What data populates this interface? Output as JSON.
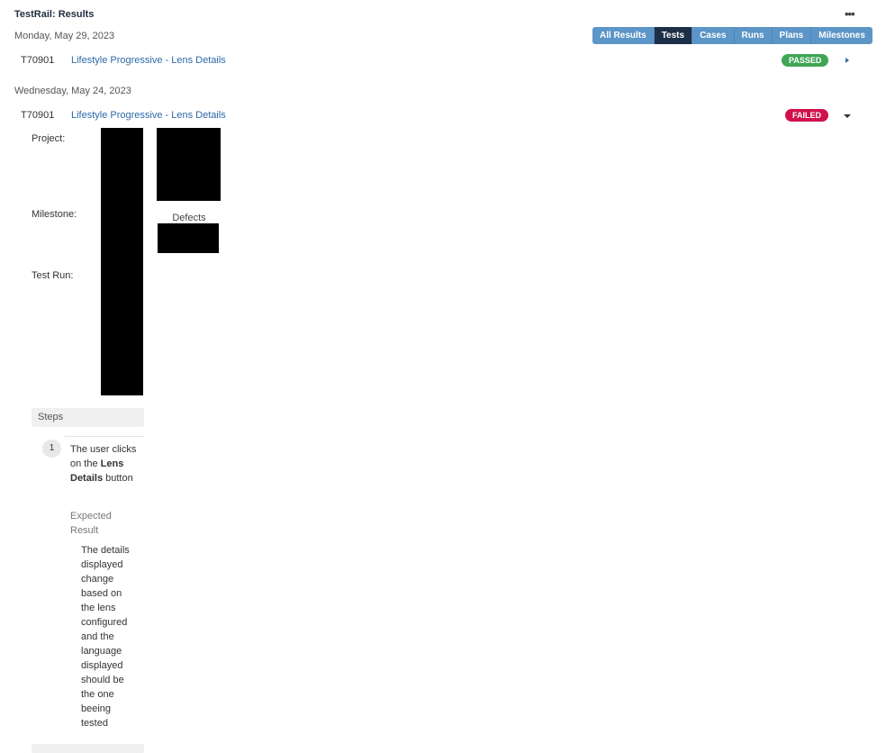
{
  "header": {
    "title": "TestRail: Results",
    "more_icon": "more-horizontal-icon"
  },
  "tabs": [
    {
      "label": "All Results",
      "active": false
    },
    {
      "label": "Tests",
      "active": true
    },
    {
      "label": "Cases",
      "active": false
    },
    {
      "label": "Runs",
      "active": false
    },
    {
      "label": "Plans",
      "active": false
    },
    {
      "label": "Milestones",
      "active": false
    }
  ],
  "groups": [
    {
      "date": "Monday, May 29, 2023",
      "results": [
        {
          "id": "T70901",
          "title": "Lifestyle Progressive - Lens Details",
          "status": "PASSED",
          "status_color": "#3fa655",
          "expanded": false
        }
      ]
    },
    {
      "date": "Wednesday, May 24, 2023",
      "results": [
        {
          "id": "T70901",
          "title": "Lifestyle Progressive - Lens Details",
          "status": "FAILED",
          "status_color": "#d0114b",
          "expanded": true
        }
      ]
    }
  ],
  "details": {
    "project_label": "Project:",
    "milestone_label": "Milestone:",
    "test_run_label": "Test Run:",
    "defects_label": "Defects",
    "steps_label": "Steps",
    "steps": [
      {
        "number": "1",
        "text_before": "The user clicks on the ",
        "text_bold": "Lens Details",
        "text_after": " button",
        "expected_label": "Expected Result",
        "expected_text": "The details displayed change based on the lens configured and the language displayed should be the one beeing tested"
      }
    ]
  },
  "colors": {
    "tab_bg": "#5c95c7",
    "tab_active_bg": "#1d2f47",
    "link": "#2d6aa8",
    "passed": "#3fa655",
    "failed": "#d0114b"
  }
}
